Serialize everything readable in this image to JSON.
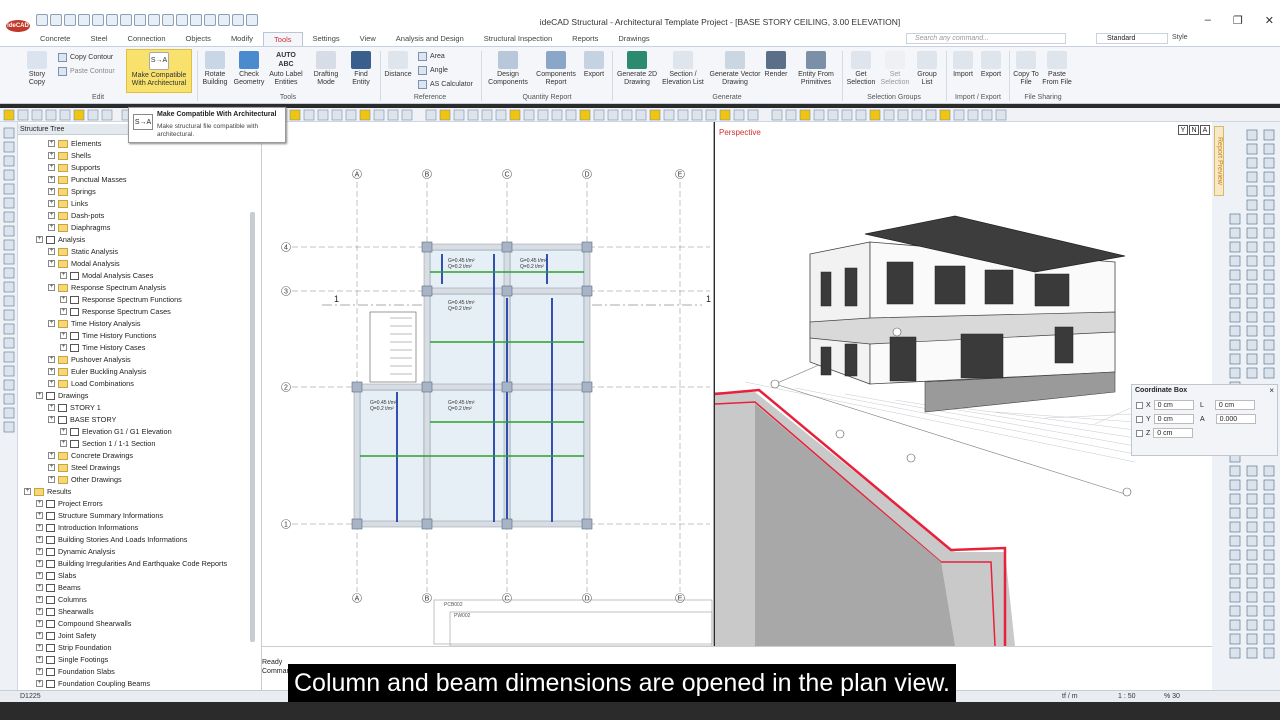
{
  "window": {
    "title": "ideCAD Structural - Architectural Template Project - [BASE STORY CEILING,  3.00 ELEVATION]",
    "logo": "ideCAD"
  },
  "tabs": [
    "Concrete",
    "Steel",
    "Connection",
    "Objects",
    "Modify",
    "Tools",
    "Settings",
    "View",
    "Analysis and Design",
    "Structural Inspection",
    "Reports",
    "Drawings"
  ],
  "search": {
    "placeholder": "Search any command..."
  },
  "style": {
    "value": "Standard",
    "label": "Style"
  },
  "ribbon": {
    "copy_contour": "Copy Contour",
    "paste_contour": "Paste Contour",
    "story_copy": "Story Copy",
    "make_compatible": "Make Compatible With Architectural",
    "group_edit": "Edit",
    "rotate_building": "Rotate Building",
    "check_geometry": "Check Geometry",
    "auto_label": "Auto Label Entities",
    "drafting_mode": "Drafting Mode",
    "find_entity": "Find Entity",
    "group_tools": "Tools",
    "distance": "Distance",
    "area": "Area",
    "angle": "Angle",
    "as_calc": "AS Calculator",
    "group_reference": "Reference",
    "design_components": "Design Components",
    "components_report": "Components Report",
    "export": "Export",
    "group_quantity": "Quantity Report",
    "gen2d": "Generate 2D Drawing",
    "section_list": "Section / Elevation List",
    "gen_vector": "Generate Vector Drawing",
    "render": "Render",
    "entity_from_primitives": "Entity From Primitives",
    "group_generate": "Generate",
    "get_selection": "Get Selection",
    "set_selection": "Set Selection",
    "group_list": "Group List",
    "group_selection": "Selection Groups",
    "import": "Import",
    "export2": "Export",
    "group_ie": "Import / Export",
    "copy_to_file": "Copy To File",
    "paste_from_file": "Paste From File",
    "group_file": "File Sharing"
  },
  "tooltip": {
    "title": "Make Compatible With Architectural",
    "desc": "Make structural file compatible with architectural.",
    "icon": "S→A"
  },
  "tree": {
    "header": "Structure Tree",
    "items": [
      "Elements",
      "Shells",
      "Supports",
      "Punctual Masses",
      "Springs",
      "Links",
      "Dash-pots",
      "Diaphragms",
      "Analysis",
      "Static Analysis",
      "Modal Analysis",
      "Modal Analysis Cases",
      "Response Spectrum Analysis",
      "Response Spectrum Functions",
      "Response Spectrum Cases",
      "Time History Analysis",
      "Time History Functions",
      "Time History Cases",
      "Pushover Analysis",
      "Euler Buckling Analysis",
      "Load Combinations",
      "Drawings",
      "STORY 1",
      "BASE STORY",
      "Elevation G1 / G1 Elevation",
      "Section 1 / 1-1 Section",
      "Concrete Drawings",
      "Steel Drawings",
      "Other Drawings",
      "Results",
      "Project Errors",
      "Structure Summary Informations",
      "Introduction Informations",
      "Building Stories And Loads Informations",
      "Dynamic Analysis",
      "Building Irregularities And Earthquake Code Reports",
      "Slabs",
      "Beams",
      "Columns",
      "Shearwalls",
      "Compound Shearwalls",
      "Joint Safety",
      "Strip Foundation",
      "Single Footings",
      "Foundation Slabs",
      "Foundation Coupling Beams"
    ]
  },
  "plan": {
    "axes_x": [
      "A",
      "B",
      "C",
      "D",
      "E"
    ],
    "axes_y": [
      "4",
      "3",
      "2",
      "1"
    ],
    "section_marks": [
      "1",
      "1"
    ],
    "slab_load": "G=0.45 t/m²",
    "slab_load2": "Q=0.2 t/m²",
    "stamp1": "PCB002",
    "stamp2": "PW002"
  },
  "perspective": {
    "label": "Perspective"
  },
  "report_preview": "Report Preview",
  "coord": {
    "title": "Coordinate Box",
    "x": "0 cm",
    "y": "0 cm",
    "z": "0 cm",
    "l": "0 cm",
    "a": "0.000",
    "xl": "X",
    "yl": "Y",
    "zl": "Z",
    "ll": "L",
    "al": "A"
  },
  "command": {
    "status": "Ready",
    "prompt": "Command:"
  },
  "statusbar": {
    "left": "D1225",
    "units": "tf / m",
    "scale": "1 : 50",
    "zoom": "% 30"
  },
  "caption": "Column and beam dimensions are opened in the plan view.",
  "colors": {
    "accent": "#c33",
    "ribbon": "#f4f6f9",
    "highlight": "#f8e16c"
  }
}
